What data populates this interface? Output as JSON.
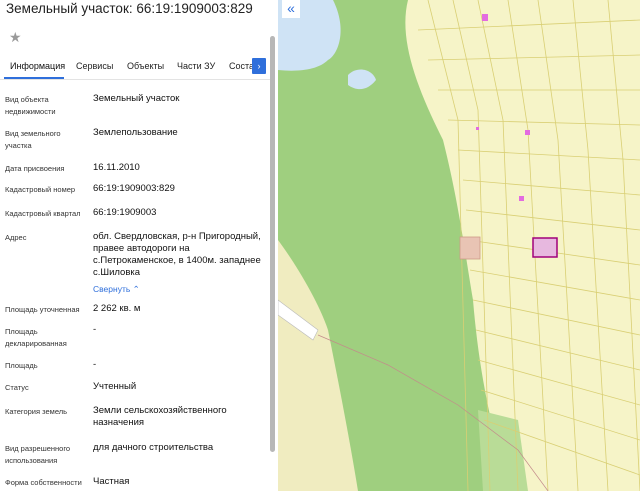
{
  "panel": {
    "title": "Земельный участок: 66:19:1909003:829",
    "star_icon": "★",
    "tabs": [
      "Информация",
      "Сервисы",
      "Объекты",
      "Части ЗУ",
      "Соста"
    ],
    "next_icon": "›"
  },
  "info": {
    "object_type": {
      "label": "Вид объекта недвижимости",
      "value": "Земельный участок"
    },
    "land_type": {
      "label": "Вид земельного участка",
      "value": "Землепользование"
    },
    "assign_date": {
      "label": "Дата присвоения",
      "value": "16.11.2010"
    },
    "cadastral_number": {
      "label": "Кадастровый номер",
      "value": "66:19:1909003:829"
    },
    "cadastral_block": {
      "label": "Кадастровый квартал",
      "value": "66:19:1909003"
    },
    "address": {
      "label": "Адрес",
      "value": "обл. Свердловская, р-н Пригородный, правее автодороги на с.Петрокаменское, в 1400м. западнее с.Шиловка",
      "collapse": "Свернуть"
    },
    "area_specified": {
      "label": "Площадь уточненная",
      "value": "2 262 кв. м"
    },
    "area_declared": {
      "label": "Площадь декларированная",
      "value": "-"
    },
    "area": {
      "label": "Площадь",
      "value": "-"
    },
    "status": {
      "label": "Статус",
      "value": "Учтенный"
    },
    "land_category": {
      "label": "Категория земель",
      "value": "Земли сельскохозяйственного назначения"
    },
    "permitted_use": {
      "label": "Вид разрешенного использования",
      "value": "для дачного строительства"
    },
    "ownership": {
      "label": "Форма собственности",
      "value": "Частная"
    }
  },
  "map": {
    "collapse_icon": "«",
    "colors": {
      "forest": "#9fcf7f",
      "light_green": "#b9dc97",
      "water": "#cfe3f5",
      "plots_bg": "#f6f4c8",
      "plot_line": "#d9cf74",
      "selected": "#a0007a",
      "pink": "#e36be0"
    }
  }
}
